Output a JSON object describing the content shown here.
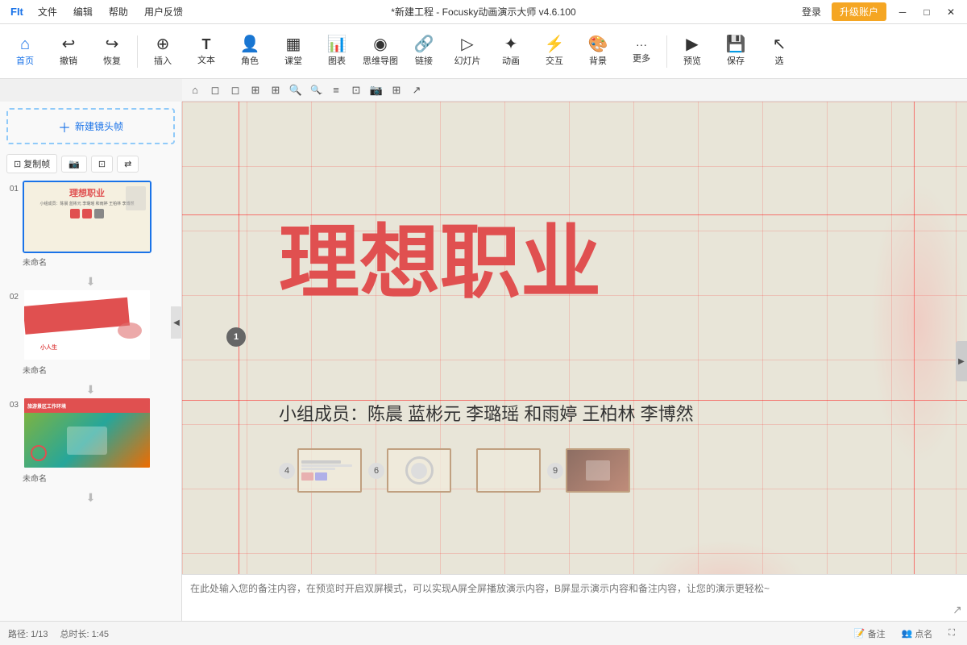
{
  "titlebar": {
    "logo": "FIt",
    "menu": [
      "文件",
      "编辑",
      "帮助",
      "用户反馈"
    ],
    "title": "*新建工程 - Focusky动画演示大师 v4.6.100",
    "login": "登录",
    "upgrade": "升级账户",
    "win_min": "─",
    "win_max": "□",
    "win_close": "✕"
  },
  "toolbar": {
    "items": [
      {
        "id": "home",
        "icon": "⌂",
        "label": "首页"
      },
      {
        "id": "undo",
        "icon": "↩",
        "label": "撤销"
      },
      {
        "id": "redo",
        "icon": "↪",
        "label": "恢复"
      },
      {
        "id": "insert",
        "icon": "⊕",
        "label": "插入"
      },
      {
        "id": "text",
        "icon": "T",
        "label": "文本"
      },
      {
        "id": "role",
        "icon": "👤",
        "label": "角色"
      },
      {
        "id": "class",
        "icon": "▦",
        "label": "课堂"
      },
      {
        "id": "chart",
        "icon": "📊",
        "label": "图表"
      },
      {
        "id": "mindmap",
        "icon": "◉",
        "label": "思维导图"
      },
      {
        "id": "link",
        "icon": "🔗",
        "label": "链接"
      },
      {
        "id": "slide",
        "icon": "▷",
        "label": "幻灯片"
      },
      {
        "id": "animation",
        "icon": "✦",
        "label": "动画"
      },
      {
        "id": "interact",
        "icon": "⚡",
        "label": "交互"
      },
      {
        "id": "bg",
        "icon": "🎨",
        "label": "背景"
      },
      {
        "id": "more",
        "icon": "···",
        "label": "更多"
      },
      {
        "id": "preview",
        "icon": "▶",
        "label": "预览"
      },
      {
        "id": "save",
        "icon": "💾",
        "label": "保存"
      },
      {
        "id": "select",
        "icon": "↖",
        "label": "选"
      }
    ]
  },
  "canvas_toolbar": {
    "tools": [
      "⌂",
      "◻",
      "◻",
      "⊞",
      "⊞",
      "🔍+",
      "🔍-",
      "≡",
      "⊡",
      "📷",
      "⊞",
      "↗"
    ]
  },
  "sidebar": {
    "new_frame_btn": "新建镜头帧",
    "copy_frame": "复制帧",
    "capture": "📷",
    "fit": "⊡",
    "arrange": "⇄",
    "slides": [
      {
        "number": "01",
        "label": "未命名",
        "type": "title",
        "active": true
      },
      {
        "number": "02",
        "label": "未命名",
        "type": "red"
      },
      {
        "number": "03",
        "label": "未命名",
        "type": "photo"
      }
    ]
  },
  "canvas": {
    "main_title": "理想职业",
    "subtitle": "小组成员：陈晨 蓝彬元 李璐瑶 和雨婷 王柏林 李博然",
    "frame_number": "1",
    "mini_frames": [
      {
        "badge": "4",
        "has_content": true,
        "text": ""
      },
      {
        "badge": "6",
        "has_content": true,
        "text": ""
      },
      {
        "badge": "",
        "has_content": false,
        "text": ""
      },
      {
        "badge": "9",
        "has_content": true,
        "text": ""
      }
    ],
    "page_counter": "01/13"
  },
  "notebar": {
    "placeholder": "在此处输入您的备注内容，在预览时开启双屏模式，可以实现A屏全屏播放演示内容，B屏显示演示内容和备注内容，让您的演示更轻松~"
  },
  "statusbar": {
    "path": "路径: 1/13",
    "total": "总时长: 1:45",
    "note": "备注",
    "point": "点名"
  }
}
